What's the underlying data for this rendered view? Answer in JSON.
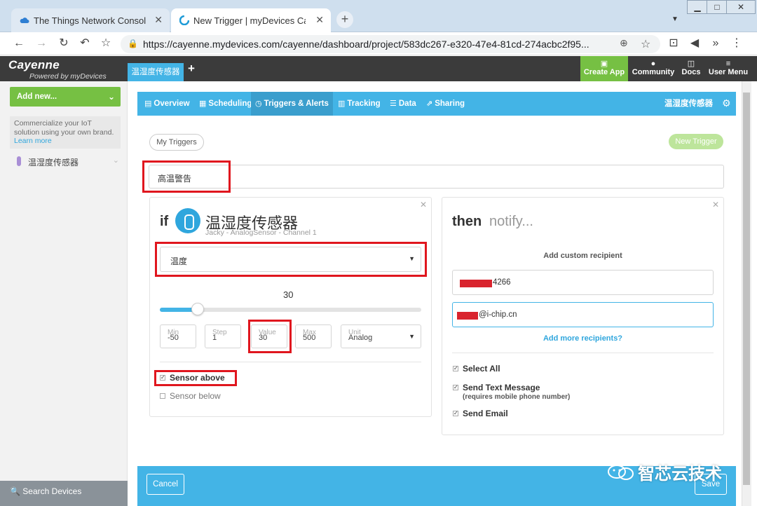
{
  "browser": {
    "tabs": [
      {
        "title": "The Things Network Console",
        "icon": "cloud-icon",
        "active": false
      },
      {
        "title": "New Trigger | myDevices Cayenne",
        "icon": "cayenne-icon",
        "active": true
      }
    ],
    "url": "https://cayenne.mydevices.com/cayenne/dashboard/project/583dc267-e320-47e4-81cd-274acbc2f95..."
  },
  "app": {
    "logo_title": "Cayenne",
    "logo_sub": "Powered by myDevices",
    "project_tab": "温湿度传感器",
    "header_buttons": {
      "create_app": "Create App",
      "community": "Community",
      "docs": "Docs",
      "user_menu": "User Menu"
    }
  },
  "sidebar": {
    "add_new": "Add new...",
    "promo_text": "Commercialize your IoT solution using your own brand.",
    "promo_link": "Learn more",
    "device": "温湿度传感器",
    "search": "Search Devices"
  },
  "nav": {
    "items": [
      "Overview",
      "Scheduling",
      "Triggers & Alerts",
      "Tracking",
      "Data",
      "Sharing"
    ],
    "active": "Triggers & Alerts",
    "project_name": "温湿度传感器"
  },
  "trigger": {
    "my_triggers": "My Triggers",
    "new_trigger": "New Trigger",
    "name": "高温警告",
    "if_label": "if",
    "device_title": "温湿度传感器",
    "device_sub": "Jacky -  AnalogSensor -  Channel 1",
    "channel_select": "温度",
    "slider": {
      "value": "30",
      "min": -50,
      "max": 500,
      "position": 30
    },
    "fields": {
      "min_label": "Min",
      "min_value": "-50",
      "step_label": "Step",
      "step_value": "1",
      "value_label": "Value",
      "value_value": "30",
      "max_label": "Max",
      "max_value": "500",
      "unit_label": "Unit",
      "unit_value": "Analog"
    },
    "sensor_above": "Sensor above",
    "sensor_below": "Sensor below",
    "then_label": "then",
    "notify_label": "notify...",
    "add_custom": "Add custom recipient",
    "recipient_phone_suffix": "4266",
    "recipient_email_suffix": "@i-chip.cn",
    "add_more": "Add more recipients?",
    "select_all": "Select All",
    "send_text": "Send Text Message",
    "send_text_note": "(requires mobile phone number)",
    "send_email": "Send Email",
    "cancel": "Cancel",
    "save": "Save"
  },
  "watermark": "智芯云技术",
  "colors": {
    "accent": "#43b4e6",
    "green": "#76c043",
    "highlight": "#e0161e"
  }
}
